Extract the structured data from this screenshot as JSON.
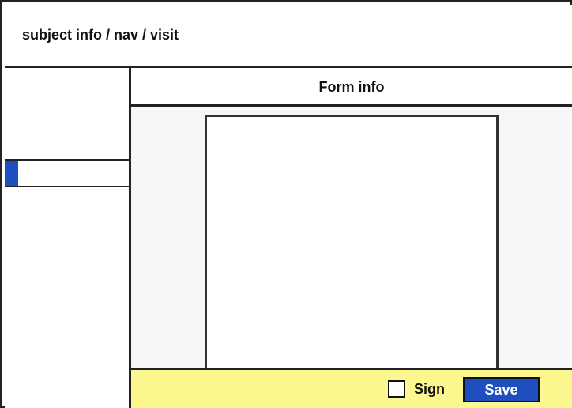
{
  "header": {
    "breadcrumb": "subject info / nav / visit"
  },
  "sidebar": {
    "items": [
      {
        "label": "",
        "selected": true
      }
    ]
  },
  "form": {
    "title": "Form info"
  },
  "footer": {
    "sign_label": "Sign",
    "sign_checked": false,
    "save_label": "Save"
  },
  "colors": {
    "accent": "#1f4fbf",
    "footer_background": "#fdf78f",
    "border": "#222222",
    "main_background": "#f6f7f9"
  }
}
